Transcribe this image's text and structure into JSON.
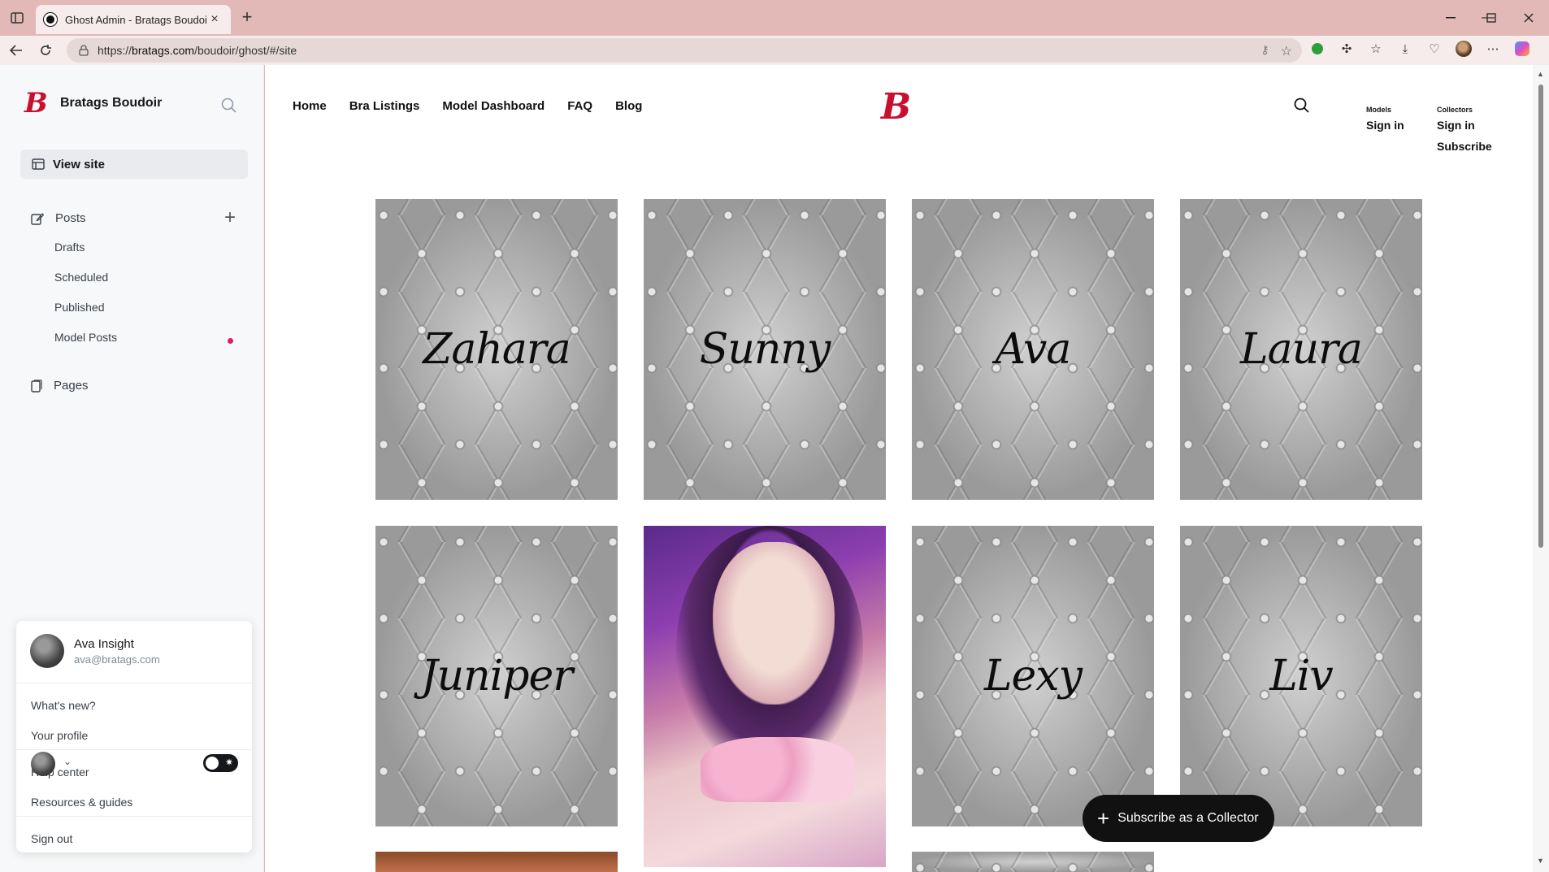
{
  "browser": {
    "tab_title": "Ghost Admin - Bratags Boudoir",
    "url_prefix": "https://",
    "url_host": "bratags.com",
    "url_path": "/boudoir/ghost/#/site",
    "theme_color": "#e3b9b7"
  },
  "sidebar": {
    "brand_name": "Bratags Boudoir",
    "brand_logo": "B",
    "view_site": "View site",
    "posts": "Posts",
    "sub_items": [
      "Drafts",
      "Scheduled",
      "Published",
      "Model Posts"
    ],
    "pages": "Pages"
  },
  "user_menu": {
    "name": "Ava Insight",
    "email": "ava@bratags.com",
    "items": [
      "What's new?",
      "Your profile",
      "Help center",
      "Resources & guides",
      "Sign out"
    ]
  },
  "site": {
    "nav": [
      "Home",
      "Bra Listings",
      "Model Dashboard",
      "FAQ",
      "Blog"
    ],
    "logo": "B",
    "models_label": "Models",
    "models_signin": "Sign in",
    "collectors_label": "Collectors",
    "collectors_signin": "Sign in",
    "collectors_subscribe": "Subscribe",
    "cards": [
      "Zahara",
      "Sunny",
      "Ava",
      "Laura",
      "Juniper",
      "",
      "Lexy",
      "Liv"
    ],
    "cta": "Subscribe as a Collector",
    "brand_color": "#c8102e"
  }
}
